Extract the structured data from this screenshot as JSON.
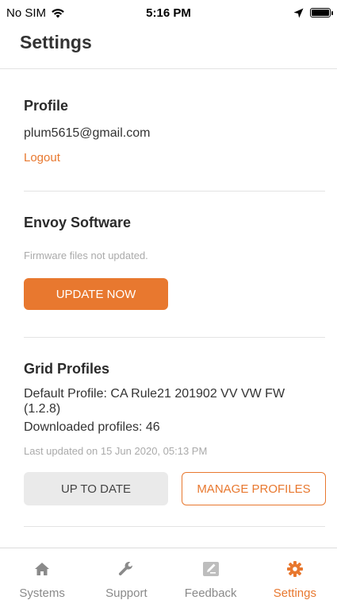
{
  "status_bar": {
    "carrier": "No SIM",
    "time": "5:16 PM"
  },
  "header": {
    "title": "Settings"
  },
  "profile": {
    "title": "Profile",
    "email": "plum5615@gmail.com",
    "logout_label": "Logout"
  },
  "envoy": {
    "title": "Envoy Software",
    "status": "Firmware files not updated.",
    "update_label": "UPDATE NOW"
  },
  "grid": {
    "title": "Grid Profiles",
    "default_profile": "Default Profile: CA Rule21 201902 VV VW FW (1.2.8)",
    "downloaded": "Downloaded profiles: 46",
    "last_updated": "Last updated on 15 Jun 2020, 05:13 PM",
    "up_to_date_label": "UP TO DATE",
    "manage_label": "MANAGE PROFILES"
  },
  "tabs": [
    {
      "label": "Systems",
      "icon": "home-icon"
    },
    {
      "label": "Support",
      "icon": "wrench-icon"
    },
    {
      "label": "Feedback",
      "icon": "feedback-icon"
    },
    {
      "label": "Settings",
      "icon": "gear-icon",
      "active": true
    }
  ],
  "colors": {
    "accent": "#e8782f",
    "muted": "#aaaaaa",
    "divider": "#e3e3e3"
  }
}
